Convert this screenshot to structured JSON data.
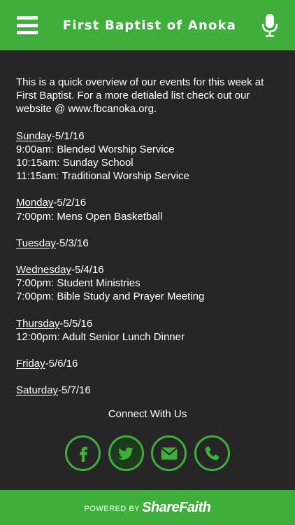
{
  "header": {
    "title": "First Baptist of Anoka",
    "menu_icon": "hamburger-menu-icon",
    "mic_icon": "microphone-icon"
  },
  "content": {
    "intro": "This is a quick overview of our events for this week at First Baptist.  For a more detialed list check out our website @ www.fbcanoka.org.",
    "days": [
      {
        "day": "Sunday",
        "date": "-5/1/16",
        "events": [
          "9:00am: Blended Worship Service",
          "10:15am: Sunday School",
          "11:15am: Traditional Worship Service"
        ]
      },
      {
        "day": "Monday",
        "date": "-5/2/16",
        "events": [
          "7:00pm: Mens Open Basketball"
        ]
      },
      {
        "day": "Tuesday",
        "date": "-5/3/16",
        "events": []
      },
      {
        "day": "Wednesday",
        "date": "-5/4/16",
        "events": [
          "7:00pm: Student Ministries",
          "7:00pm: Bible Study and Prayer Meeting"
        ]
      },
      {
        "day": "Thursday",
        "date": "-5/5/16",
        "events": [
          "12:00pm: Adult Senior Lunch Dinner"
        ]
      },
      {
        "day": "Friday",
        "date": "-5/6/16",
        "events": []
      },
      {
        "day": "Saturday",
        "date": "-5/7/16",
        "events": []
      }
    ]
  },
  "connect": {
    "title": "Connect With Us",
    "icons": [
      "facebook-icon",
      "twitter-icon",
      "email-icon",
      "phone-icon"
    ]
  },
  "footer": {
    "powered_by": "POWERED BY",
    "brand": "ShareFaith"
  },
  "colors": {
    "accent": "#3fae3a",
    "background": "#262626",
    "text": "#ffffff"
  }
}
